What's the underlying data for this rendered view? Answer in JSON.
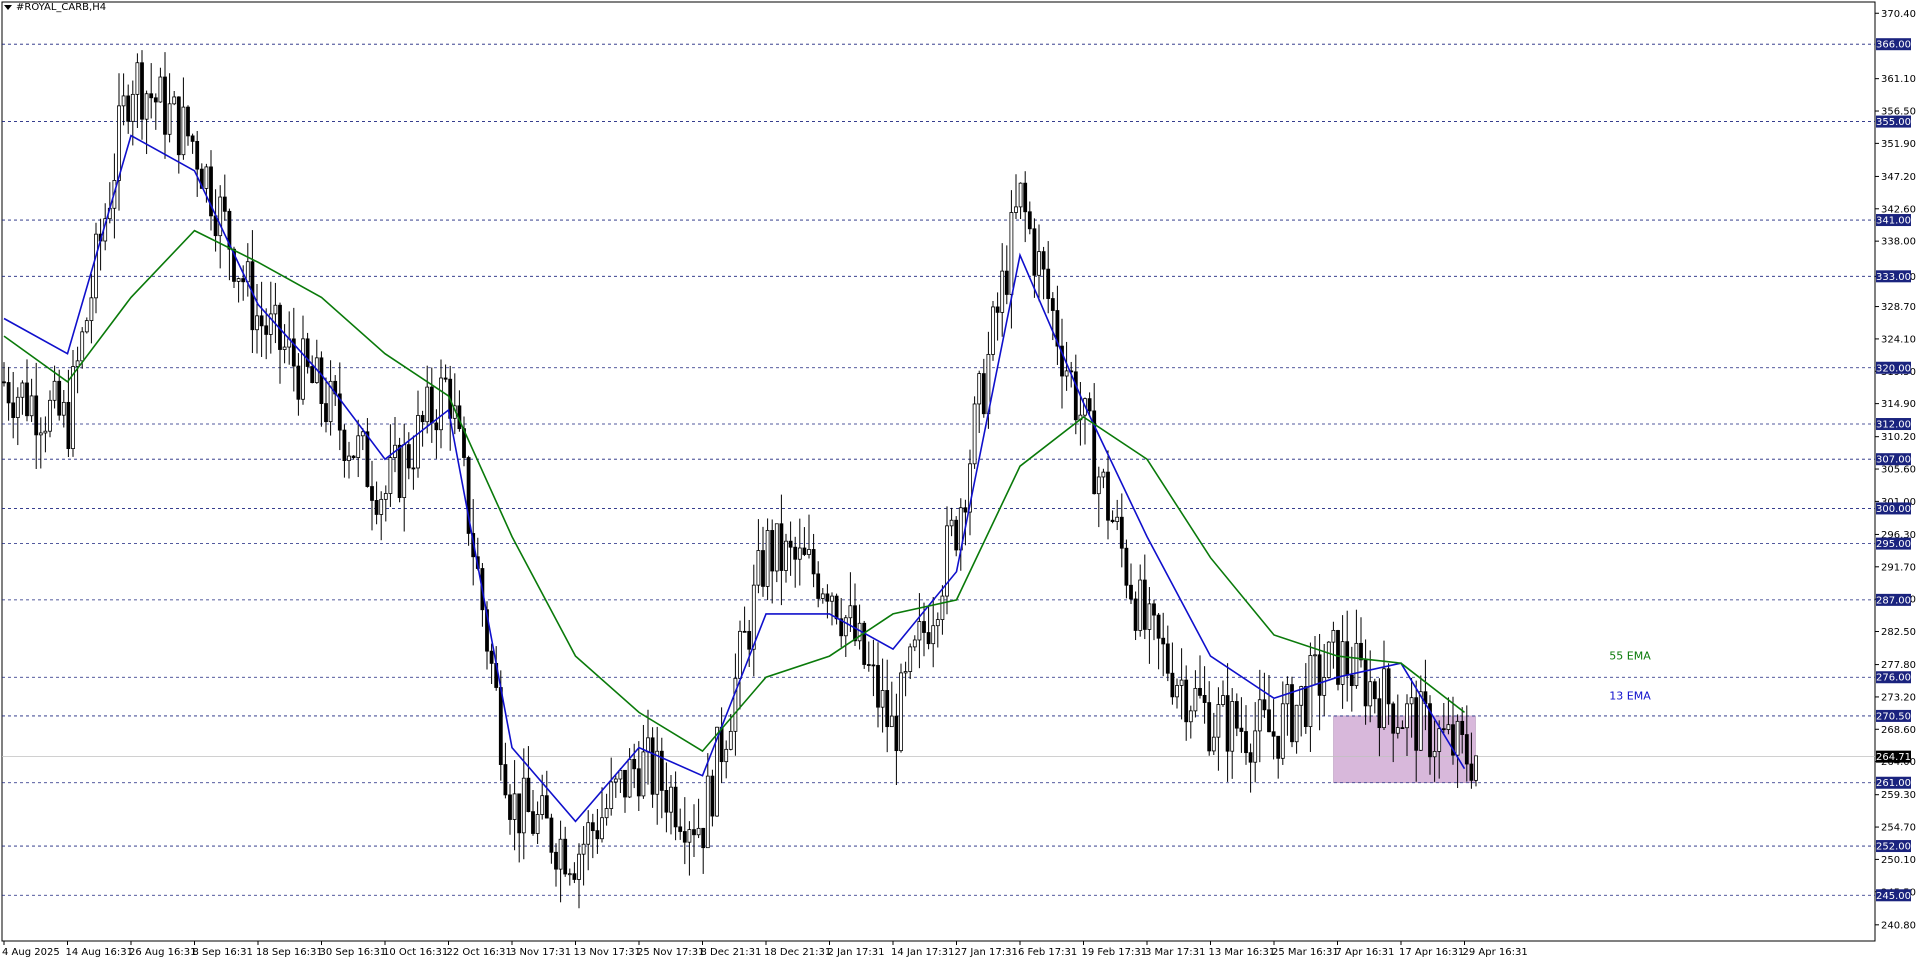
{
  "window": {
    "title": "#ROYAL_CARB,H4"
  },
  "chart_data": {
    "type": "candlestick",
    "symbol": "#ROYAL_CARB",
    "timeframe": "H4",
    "y_axis": {
      "range": [
        238.5,
        372.0
      ],
      "ticks": [
        370.4,
        361.1,
        356.5,
        351.9,
        347.2,
        342.6,
        338.0,
        333.0,
        328.7,
        324.1,
        319.5,
        314.9,
        310.2,
        305.6,
        301.0,
        296.3,
        291.7,
        287.1,
        282.5,
        277.8,
        273.2,
        268.6,
        264.0,
        259.3,
        254.7,
        250.1,
        245.5,
        240.8
      ]
    },
    "x_axis": {
      "ticks": [
        "4 Aug 2025",
        "14 Aug 16:31",
        "26 Aug 16:31",
        "8 Sep 16:31",
        "18 Sep 16:31",
        "30 Sep 16:31",
        "10 Oct 16:31",
        "22 Oct 16:31",
        "3 Nov 17:31",
        "13 Nov 17:31",
        "25 Nov 17:31",
        "8 Dec 21:31",
        "18 Dec 21:31",
        "2 Jan 17:31",
        "14 Jan 17:31",
        "27 Jan 17:31",
        "6 Feb 17:31",
        "19 Feb 17:31",
        "3 Mar 17:31",
        "13 Mar 16:31",
        "25 Mar 16:31",
        "7 Apr 16:31",
        "17 Apr 16:31",
        "29 Apr 16:31"
      ]
    },
    "horizontal_levels": [
      {
        "label": "366.00",
        "value": 366.0
      },
      {
        "label": "355.00",
        "value": 355.0
      },
      {
        "label": "341.00",
        "value": 341.0
      },
      {
        "label": "333.00",
        "value": 333.0
      },
      {
        "label": "320.00",
        "value": 320.0
      },
      {
        "label": "312.00",
        "value": 312.0
      },
      {
        "label": "307.00",
        "value": 307.0
      },
      {
        "label": "300.00",
        "value": 300.0
      },
      {
        "label": "295.00",
        "value": 295.0
      },
      {
        "label": "287.00",
        "value": 287.0
      },
      {
        "label": "276.00",
        "value": 276.0
      },
      {
        "label": "270.50",
        "value": 270.5
      },
      {
        "label": "261.00",
        "value": 261.0
      },
      {
        "label": "252.00",
        "value": 252.0
      },
      {
        "label": "245.00",
        "value": 245.0
      }
    ],
    "current_price": {
      "label": "264.71",
      "value": 264.71
    },
    "zone": {
      "from_label": "7 Apr 16:31",
      "price_low": 261.0,
      "price_high": 270.5
    },
    "series": [
      {
        "name": "13 EMA",
        "color": "#1010cc",
        "points": [
          [
            "4 Aug 2025",
            327.0
          ],
          [
            "14 Aug 16:31",
            322.0
          ],
          [
            "26 Aug 16:31",
            353.0
          ],
          [
            "8 Sep 16:31",
            348.0
          ],
          [
            "18 Sep 16:31",
            329.0
          ],
          [
            "30 Sep 16:31",
            319.0
          ],
          [
            "10 Oct 16:31",
            307.0
          ],
          [
            "22 Oct 16:31",
            314.0
          ],
          [
            "3 Nov 17:31",
            266.0
          ],
          [
            "13 Nov 17:31",
            255.5
          ],
          [
            "25 Nov 17:31",
            266.0
          ],
          [
            "8 Dec 21:31",
            262.0
          ],
          [
            "18 Dec 21:31",
            285.0
          ],
          [
            "2 Jan 17:31",
            285.0
          ],
          [
            "14 Jan 17:31",
            280.0
          ],
          [
            "27 Jan 17:31",
            291.0
          ],
          [
            "6 Feb 17:31",
            336.0
          ],
          [
            "19 Feb 17:31",
            315.0
          ],
          [
            "3 Mar 17:31",
            296.0
          ],
          [
            "13 Mar 16:31",
            279.0
          ],
          [
            "25 Mar 16:31",
            273.0
          ],
          [
            "7 Apr 16:31",
            276.0
          ],
          [
            "17 Apr 16:31",
            278.0
          ],
          [
            "29 Apr 16:31",
            263.0
          ]
        ]
      },
      {
        "name": "55 EMA",
        "color": "#0a7a0a",
        "points": [
          [
            "4 Aug 2025",
            324.5
          ],
          [
            "14 Aug 16:31",
            318.0
          ],
          [
            "26 Aug 16:31",
            330.0
          ],
          [
            "8 Sep 16:31",
            339.5
          ],
          [
            "18 Sep 16:31",
            335.0
          ],
          [
            "30 Sep 16:31",
            330.0
          ],
          [
            "10 Oct 16:31",
            322.0
          ],
          [
            "22 Oct 16:31",
            316.0
          ],
          [
            "3 Nov 17:31",
            296.0
          ],
          [
            "13 Nov 17:31",
            279.0
          ],
          [
            "25 Nov 17:31",
            271.0
          ],
          [
            "8 Dec 21:31",
            265.5
          ],
          [
            "18 Dec 21:31",
            276.0
          ],
          [
            "2 Jan 17:31",
            279.0
          ],
          [
            "14 Jan 17:31",
            285.0
          ],
          [
            "27 Jan 17:31",
            287.0
          ],
          [
            "6 Feb 17:31",
            306.0
          ],
          [
            "19 Feb 17:31",
            313.0
          ],
          [
            "3 Mar 17:31",
            307.0
          ],
          [
            "13 Mar 16:31",
            293.0
          ],
          [
            "25 Mar 16:31",
            282.0
          ],
          [
            "7 Apr 16:31",
            279.0
          ],
          [
            "17 Apr 16:31",
            278.0
          ],
          [
            "29 Apr 16:31",
            271.0
          ]
        ]
      }
    ],
    "annotations": [
      {
        "text": "55 EMA",
        "color": "#0a7a0a",
        "value": 278.5
      },
      {
        "text": "13 EMA",
        "color": "#1010cc",
        "value": 272.8
      }
    ],
    "price_path": [
      [
        "4 Aug 2025",
        318
      ],
      [
        "14 Aug 16:31",
        312
      ],
      [
        "26 Aug 16:31",
        362
      ],
      [
        "8 Sep 16:31",
        352
      ],
      [
        "18 Sep 16:31",
        327
      ],
      [
        "30 Sep 16:31",
        316
      ],
      [
        "10 Oct 16:31",
        302
      ],
      [
        "22 Oct 16:31",
        318
      ],
      [
        "3 Nov 17:31",
        258
      ],
      [
        "13 Nov 17:31",
        251
      ],
      [
        "25 Nov 17:31",
        264
      ],
      [
        "8 Dec 21:31",
        255
      ],
      [
        "18 Dec 21:31",
        294
      ],
      [
        "2 Jan 17:31",
        290
      ],
      [
        "14 Jan 17:31",
        268
      ],
      [
        "27 Jan 17:31",
        298
      ],
      [
        "6 Feb 17:31",
        344
      ],
      [
        "19 Feb 17:31",
        312
      ],
      [
        "3 Mar 17:31",
        282
      ],
      [
        "13 Mar 16:31",
        270
      ],
      [
        "25 Mar 16:31",
        268
      ],
      [
        "7 Apr 16:31",
        279
      ],
      [
        "17 Apr 16:31",
        271
      ],
      [
        "29 Apr 16:31",
        265
      ]
    ],
    "grid": false,
    "colors": {
      "level_line": "#1a237e",
      "level_label_bg": "#1a237e",
      "current_label_bg": "#000000",
      "zone_fill": "#d8b8db",
      "candles": "#000000"
    }
  }
}
